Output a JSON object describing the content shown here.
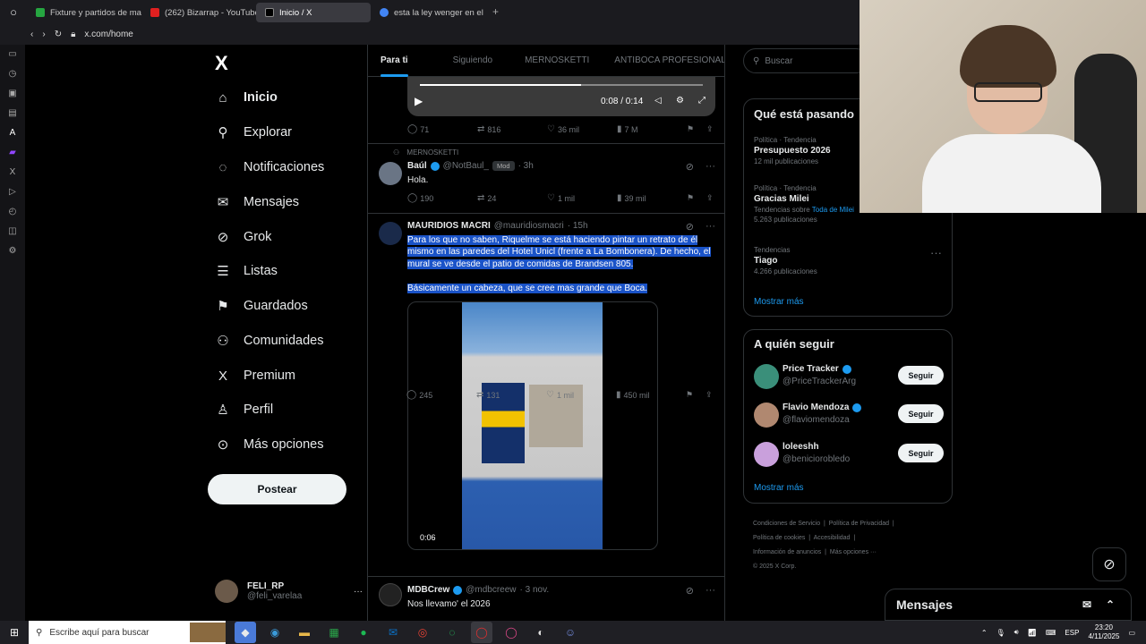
{
  "browser": {
    "tabs": [
      {
        "label": "Fixture y partidos de maí",
        "color": "#26a641"
      },
      {
        "label": "(262) Bizarrap - YouTube",
        "color": "#e02020"
      },
      {
        "label": "Inicio / X",
        "color": "#000000"
      },
      {
        "label": "esta la ley wenger en el m",
        "color": "#4285f4"
      }
    ],
    "new_tab": "+",
    "url": "x.com/home"
  },
  "nav": {
    "logo": "X",
    "items": [
      {
        "label": "Inicio",
        "icon": "home-icon",
        "glyph": "⌂"
      },
      {
        "label": "Explorar",
        "icon": "search-icon",
        "glyph": "⚲"
      },
      {
        "label": "Notificaciones",
        "icon": "bell-icon",
        "glyph": "🔔"
      },
      {
        "label": "Mensajes",
        "icon": "mail-icon",
        "glyph": "✉"
      },
      {
        "label": "Grok",
        "icon": "grok-icon",
        "glyph": "⊘"
      },
      {
        "label": "Listas",
        "icon": "list-icon",
        "glyph": "☰"
      },
      {
        "label": "Guardados",
        "icon": "bookmark-icon",
        "glyph": "🔖"
      },
      {
        "label": "Comunidades",
        "icon": "people-icon",
        "glyph": "👥"
      },
      {
        "label": "Premium",
        "icon": "x-premium-icon",
        "glyph": "X"
      },
      {
        "label": "Perfil",
        "icon": "person-icon",
        "glyph": "👤"
      },
      {
        "label": "Más opciones",
        "icon": "more-circle-icon",
        "glyph": "⋯"
      }
    ],
    "post_button": "Postear",
    "account": {
      "name": "FELI_RP",
      "handle": "@feli_varelaa",
      "more": "···"
    }
  },
  "feed": {
    "tabs": [
      "Para ti",
      "Siguiendo",
      "MERNOSKETTI",
      "ANTIBOCA PROFESIONAL"
    ],
    "video_top": {
      "time": "0:08 / 0:14",
      "progress": 0.57
    },
    "post0_actions": {
      "replies": "71",
      "reposts": "816",
      "likes": "36 mil",
      "views": "7 M"
    },
    "post1": {
      "community": "MERNOSKETTI",
      "name": "Baúl",
      "handle": "@NotBaul_",
      "badge": "Mod",
      "time": "· 3h",
      "text": "Hola.",
      "replies": "190",
      "reposts": "24",
      "likes": "1 mil",
      "views": "39 mil"
    },
    "post2": {
      "name": "MAURIDIOS MACRI",
      "handle": "@mauridiosmacri",
      "time": "· 15h",
      "text1": "Para los que no saben, Riquelme se está haciendo pintar un retrato de él mismo en las paredes del Hotel Unicl (frente a La Bombonera). De hecho, el mural se ve desde el patio de comidas de Brandsen 805.",
      "text2": "Básicamente un cabeza, que se cree mas grande que Boca.",
      "video_time": "0:06",
      "replies": "245",
      "reposts": "131",
      "likes": "1 mil",
      "views": "450 mil"
    },
    "post3": {
      "name": "MDBCrew",
      "handle": "@mdbcreew",
      "time": "· 3 nov.",
      "text": "Nos llevamo' el 2026"
    }
  },
  "sidebar": {
    "search_placeholder": "Buscar",
    "trends_title": "Qué está pasando",
    "trends": [
      {
        "context": "Política · Tendencia",
        "title": "Presupuesto 2026",
        "count": "12 mil publicaciones",
        "extra": ""
      },
      {
        "context": "Política · Tendencia",
        "title": "Gracias Milei",
        "count": "Tendencias sobre ",
        "extra": "Toda de Milei"
      },
      {
        "context": "",
        "title": "",
        "count": "5.263 publicaciones",
        "extra": ""
      },
      {
        "context": "Tendencias",
        "title": "Tiago",
        "count": "4.266 publicaciones",
        "extra": ""
      }
    ],
    "trends_more": "Mostrar más",
    "who_title": "A quién seguir",
    "who": [
      {
        "name": "Price Tracker",
        "handle": "@PriceTrackerArg",
        "verified": true,
        "follow": "Seguir",
        "color": "#3a8f7a"
      },
      {
        "name": "Flavio Mendoza",
        "handle": "@flaviomendoza",
        "verified": true,
        "follow": "Seguir",
        "color": "#b08870"
      },
      {
        "name": "loleeshh",
        "handle": "@beniciorobledo",
        "verified": false,
        "follow": "Seguir",
        "color": "#c9a0dc"
      }
    ],
    "who_more": "Mostrar más",
    "footer": [
      "Condiciones de Servicio",
      "Política de Privacidad",
      "Política de cookies",
      "Accesibilidad",
      "Información de anuncios",
      "Más opciones ···",
      "© 2025 X Corp."
    ]
  },
  "messages_dock": {
    "title": "Mensajes"
  },
  "taskbar": {
    "search_placeholder": "Escribe aquí para buscar",
    "lang": "ESP",
    "time": "23:20",
    "date": "4/11/2025"
  }
}
